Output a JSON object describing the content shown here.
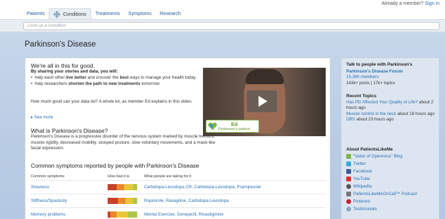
{
  "header": {
    "member_prompt": "Already a member?",
    "signin": "Sign in"
  },
  "nav": {
    "items": [
      "Patients",
      "Conditions",
      "Treatments",
      "Symptoms",
      "Research"
    ],
    "active": "Conditions"
  },
  "search": {
    "placeholder": "Look up a condition"
  },
  "page_title": "Parkinson's Disease",
  "intro": {
    "heading": "We're all in this for good.",
    "lead": "By sharing your stories and data, you will:",
    "bullet1_pre": "help each other ",
    "bullet1_bold": "live better",
    "bullet1_mid": " and uncover the ",
    "bullet1_bold2": "best",
    "bullet1_post": " ways to manage your health today",
    "bullet2_pre": "help researchers ",
    "bullet2_bold": "shorten the path to new treatments",
    "bullet2_post": " tomorrow",
    "howmuch": "How much good can your data do? A whole lot, as member Ed explains in this video.",
    "see_more": "See more"
  },
  "what": {
    "heading": "What is Parkinson's Disease?",
    "body": "Parkinson's Disease is a progressive disorder of the nervous system marked by muscle tremors, muscle rigidity, decreased mobility, stooped posture, slow voluntary movements, and a mask-like facial expression."
  },
  "video": {
    "badge_name": "Ed",
    "badge_role": "Parkinson's patient"
  },
  "symptoms": {
    "heading": "Common symptoms reported by people with Parkinson's Disease",
    "col_symptom": "Common symptoms",
    "col_bad": "How bad it is",
    "col_treat": "What people are taking for it",
    "rows": [
      {
        "symptom": "Slowness",
        "treatments": "Carbidopa-Levodopa CR, Carbidopa-Levodopa, Pramipexole",
        "severity": [
          0.3,
          0.25,
          0.3,
          0.15
        ]
      },
      {
        "symptom": "Stiffness/Spasticity",
        "treatments": "Ropinirole, Rasagiline, Carbidopa-Levodopa",
        "severity": [
          0.35,
          0.25,
          0.25,
          0.15
        ]
      },
      {
        "symptom": "Memory problems",
        "treatments": "Mental Exercise, Donepezil, Rivastigmine",
        "severity": [
          0.1,
          0.2,
          0.4,
          0.3
        ]
      }
    ],
    "colors": [
      "#c8412b",
      "#e8892a",
      "#e8c83a",
      "#a9c84a"
    ]
  },
  "sidebar": {
    "talk_heading": "Talk to people with Parkinson's",
    "forum": "Parkinson's Disease Forum",
    "members": "15,380 members",
    "posts": "143k+ posts | 17k+ topics",
    "recent_heading": "Recent Topics",
    "topic1_link": "Has PD Affected Your Quality of Life?",
    "topic1_time": " about 2 hours ago",
    "topic2_link": "Muscle control in the neck",
    "topic2_time": " about 18 hours ago",
    "topic3_link": "DBS",
    "topic3_time": " about 23 hours ago",
    "about_heading": "About PatientsLikeMe",
    "links": [
      "\"Value of Openness\" Blog",
      "Twitter",
      "Facebook",
      "YouTube",
      "Wikipedia",
      "PatientsLikeMeOnCall™ Podcast",
      "Pinterest",
      "Testimonials"
    ]
  }
}
